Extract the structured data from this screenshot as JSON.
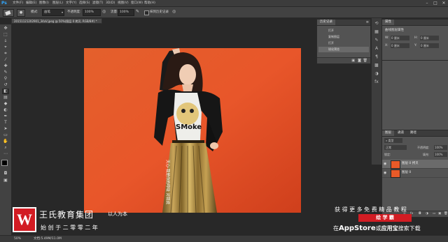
{
  "app": {
    "logo": "Ps"
  },
  "menubar": {
    "items": [
      "文件(F)",
      "编辑(E)",
      "图像(I)",
      "图层(L)",
      "文字(Y)",
      "选择(S)",
      "滤镜(T)",
      "3D(D)",
      "视图(V)",
      "窗口(W)",
      "帮助(H)"
    ]
  },
  "window_controls": {
    "minimize": "–",
    "maximize": "□",
    "close": "✕"
  },
  "options_bar": {
    "mode_label": "模式:",
    "mode_value": "画笔",
    "opacity_label": "不透明度:",
    "opacity_value": "100%",
    "flow_label": "流量:",
    "flow_value": "100%",
    "history_toggle_label": "抹到历史记录"
  },
  "document": {
    "tab_title": "20151121202901_34aV.jpeg @ 50%(图层 0 拷贝, RGB/8#) *"
  },
  "history_panel": {
    "tabs": [
      "历史记录"
    ],
    "rows": [
      "打开",
      "复制图层",
      "打开",
      "锐化预览"
    ],
    "selected_index": 3
  },
  "properties_panel": {
    "tab": "属性",
    "title": "曲线图层属性",
    "w_label": "W:",
    "w_value": "0 厘米",
    "h_label": "H:",
    "h_value": "0 厘米",
    "x_label": "X:",
    "x_value": "0 厘米",
    "y_label": "Y:",
    "y_value": "0 厘米"
  },
  "layers_panel": {
    "tabs": [
      "图层",
      "通道",
      "路径"
    ],
    "kind_label": "类型",
    "blend_mode": "正常",
    "opacity_label": "不透明度:",
    "opacity_value": "100%",
    "lock_label": "锁定:",
    "fill_label": "填充:",
    "fill_value": "100%",
    "layers": [
      {
        "name": "图层 0 拷贝",
        "selected": true
      },
      {
        "name": "图层 0",
        "selected": false
      }
    ]
  },
  "status_bar": {
    "zoom": "50%",
    "doc_info": "文档:5.49M/11.0M"
  },
  "watermark": {
    "logo_letter": "W",
    "company": "王氏教育集团",
    "slogan": "以人为本",
    "founded": "始 创 于 二 零 零 二 年",
    "promo_line1": "获 得 更 多 免 费 精 品 教 程",
    "promo_badge": "绘 学 霸",
    "promo_line3_a": "在",
    "promo_line3_b": "AppStore",
    "promo_line3_c": "或",
    "promo_line3_d": "应用宝",
    "promo_line3_e": "搜索下载"
  },
  "canvas_text": {
    "shirt": "SMoke",
    "skirt_vertical": "天心·我是你的呼吸 对我说"
  },
  "colors": {
    "bg": "#282828",
    "panel": "#535353",
    "canvas_orange": "#e85a28",
    "brand_red": "#d21c23",
    "accent": "#31a8ff"
  }
}
